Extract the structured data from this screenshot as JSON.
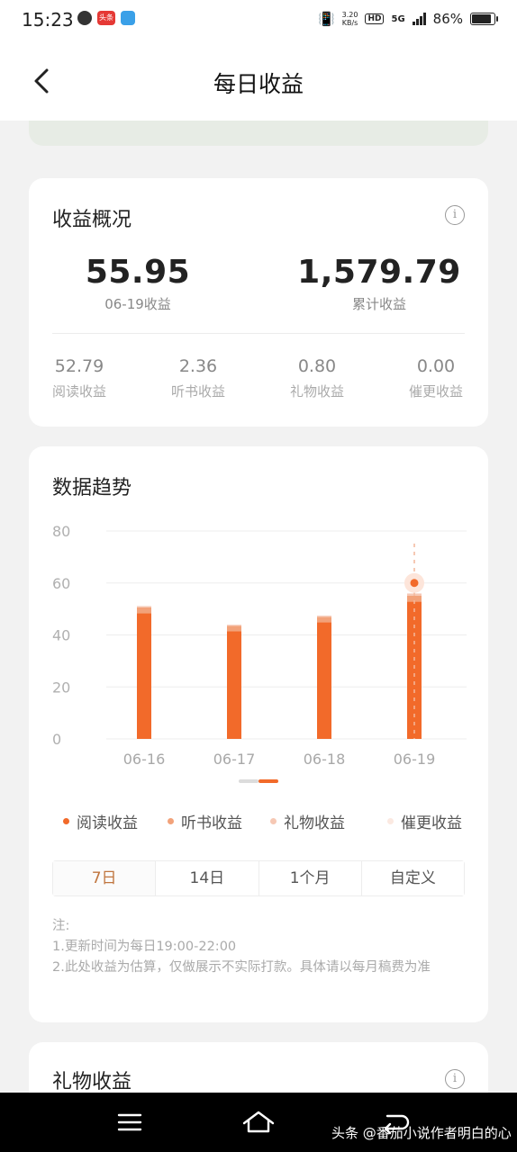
{
  "status_bar": {
    "time": "15:23",
    "news_badge": "头条",
    "net_speed_value": "3.20",
    "net_speed_unit": "KB/s",
    "hd": "HD",
    "network": "5G",
    "battery": "86%"
  },
  "header": {
    "title": "每日收益"
  },
  "overview": {
    "title": "收益概况",
    "today_value": "55.95",
    "today_label": "06-19收益",
    "total_value": "1,579.79",
    "total_label": "累计收益",
    "breakdown": [
      {
        "value": "52.79",
        "label": "阅读收益"
      },
      {
        "value": "2.36",
        "label": "听书收益"
      },
      {
        "value": "0.80",
        "label": "礼物收益"
      },
      {
        "value": "0.00",
        "label": "催更收益"
      }
    ]
  },
  "trend": {
    "title": "数据趋势",
    "tabs": [
      "7日",
      "14日",
      "1个月",
      "自定义"
    ],
    "active_tab": "7日",
    "notes": [
      "注:",
      "1.更新时间为每日19:00-22:00",
      "2.此处收益为估算，仅做展示不实际打款。具体请以每月稿费为准"
    ]
  },
  "gift": {
    "title": "礼物收益"
  },
  "watermark": "头条 @番茄小说作者明白的心",
  "colors": {
    "reading": "#f26a2a",
    "audiobook": "#f2a27a",
    "gift": "#f6c8b4",
    "urge": "#fbe9e1",
    "active_tab": "#c0753e"
  },
  "chart_data": {
    "type": "bar",
    "stacked": true,
    "categories": [
      "06-16",
      "06-17",
      "06-18",
      "06-19"
    ],
    "series": [
      {
        "name": "阅读收益",
        "values": [
          48.3,
          41.4,
          44.9,
          52.79
        ]
      },
      {
        "name": "听书收益",
        "values": [
          2.3,
          2.1,
          2.0,
          2.36
        ]
      },
      {
        "name": "礼物收益",
        "values": [
          0.5,
          0.4,
          0.5,
          0.8
        ]
      },
      {
        "name": "催更收益",
        "values": [
          0,
          0,
          0,
          0
        ]
      }
    ],
    "y_ticks": [
      0,
      20,
      40,
      60,
      80
    ],
    "ylim": [
      0,
      80
    ],
    "highlighted_category": "06-19",
    "highlight_marker_value": 60,
    "grid": true,
    "legend": "bottom"
  }
}
